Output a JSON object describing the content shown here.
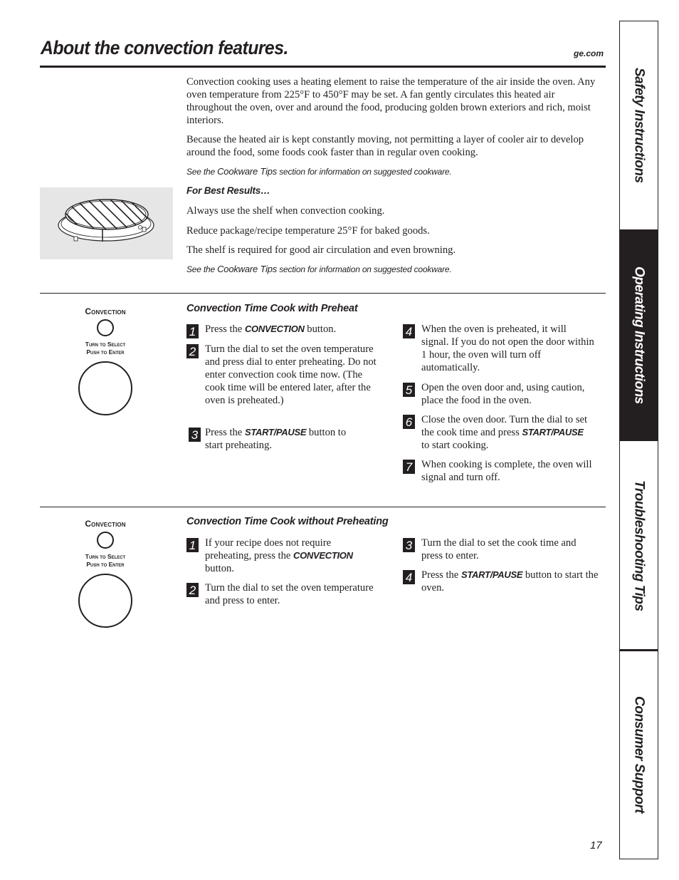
{
  "header": {
    "title": "About the convection features.",
    "site": "ge.com"
  },
  "intro": {
    "paragraphs": [
      "Convection cooking uses a heating element to raise the temperature of the air inside the oven. Any oven temperature from 225°F to 450°F may be set. A fan gently circulates this heated air throughout the oven, over and around the food, producing golden brown exteriors and rich, moist interiors.",
      "Because the heated air is kept constantly moving, not permitting a layer of cooler air to develop around the food, some foods cook faster than in regular oven cooking."
    ],
    "note_prefix": "See the ",
    "note_link": "Cookware Tips",
    "note_suffix": " section for information on suggested cookware."
  },
  "best_results": {
    "heading": "For Best Results…",
    "illustration": "convection-shelf-icon",
    "items": [
      "Always use the shelf when convection cooking.",
      "Reduce package/recipe temperature 25°F for baked goods.",
      "The shelf is required for good air circulation and even browning."
    ],
    "note_prefix": "See the ",
    "note_link": "Cookware Tips",
    "note_suffix": " section for information on suggested cookware."
  },
  "control_panel": {
    "button_label": "Convection",
    "dial_line1": "Turn to Select",
    "dial_line2": "Push to Enter"
  },
  "section_preheat": {
    "heading": "Convection Time Cook with Preheat",
    "steps": [
      {
        "num": "1",
        "pre": "Press the ",
        "kw": "CONVECTION",
        "post": " button."
      },
      {
        "num": "2",
        "pre": "Turn the dial to set the oven temperature and press dial to enter preheating. Do not enter convection cook time now. (The cook time will be entered later, after the oven is preheated.)",
        "kw": "",
        "post": ""
      },
      {
        "num": "3",
        "pre": "Press the ",
        "kw": "START/PAUSE",
        "post": " button to start preheating."
      },
      {
        "num": "4",
        "pre": "When the oven is preheated, it will signal. If you do not open the door within 1 hour, the oven will turn off automatically.",
        "kw": "",
        "post": ""
      },
      {
        "num": "5",
        "pre": "Open the oven door and, using caution, place the food in the oven.",
        "kw": "",
        "post": ""
      },
      {
        "num": "6",
        "pre": "Close the oven door. Turn the dial to set the cook time and press ",
        "kw": "START/PAUSE",
        "post": " to start cooking."
      },
      {
        "num": "7",
        "pre": "When cooking is complete, the oven will signal and turn off.",
        "kw": "",
        "post": ""
      }
    ]
  },
  "section_no_preheat": {
    "heading": "Convection Time Cook without Preheating",
    "steps": [
      {
        "num": "1",
        "pre": "If your recipe does not require preheating, press the ",
        "kw": "CONVECTION",
        "post": " button."
      },
      {
        "num": "2",
        "pre": "Turn the dial to set the oven temperature and press to enter.",
        "kw": "",
        "post": ""
      },
      {
        "num": "3",
        "pre": "Turn the dial to set the cook time and press to enter.",
        "kw": "",
        "post": ""
      },
      {
        "num": "4",
        "pre": "Press the ",
        "kw": "START/PAUSE",
        "post": " button to start the oven."
      }
    ]
  },
  "side_tabs": [
    {
      "label": "Safety Instructions",
      "active": false
    },
    {
      "label": "Operating Instructions",
      "active": true
    },
    {
      "label": "Troubleshooting Tips",
      "active": false
    },
    {
      "label": "Consumer Support",
      "active": false
    }
  ],
  "page_number": "17",
  "colors": {
    "ink": "#231f20",
    "shelf_bg": "#e6e6e6"
  }
}
